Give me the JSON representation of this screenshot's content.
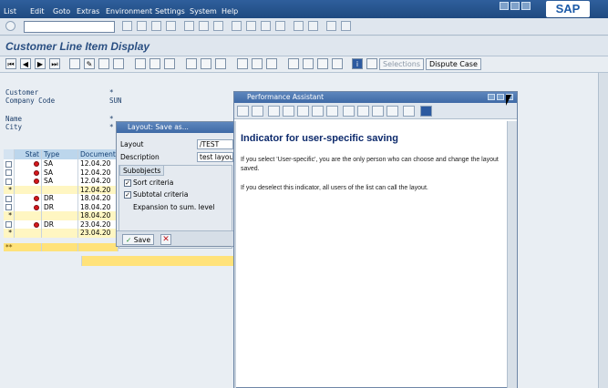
{
  "menu": {
    "items": [
      "List",
      "Edit",
      "Goto",
      "Extras",
      "Environment",
      "Settings",
      "System",
      "Help"
    ],
    "logo": "SAP"
  },
  "screen": {
    "title": "Customer Line Item Display"
  },
  "app_toolbar": {
    "selections_label": "Selections",
    "dispute_label": "Dispute Case"
  },
  "header": {
    "customer_label": "Customer",
    "customer_value": "*",
    "company_label": "Company Code",
    "company_value": "SUN",
    "name_label": "Name",
    "name_value": "*",
    "city_label": "City",
    "city_value": "*"
  },
  "grid": {
    "columns": [
      "Stat",
      "Type",
      "Document"
    ],
    "rows": [
      {
        "kind": "row",
        "type": "SA",
        "date": "12.04.20"
      },
      {
        "kind": "row",
        "type": "SA",
        "date": "12.04.20"
      },
      {
        "kind": "row",
        "type": "SA",
        "date": "12.04.20"
      },
      {
        "kind": "sub",
        "type": "",
        "date": "12.04.20"
      },
      {
        "kind": "row",
        "type": "DR",
        "date": "18.04.20"
      },
      {
        "kind": "row",
        "type": "DR",
        "date": "18.04.20"
      },
      {
        "kind": "sub",
        "type": "",
        "date": "18.04.20"
      },
      {
        "kind": "row",
        "type": "DR",
        "date": "23.04.20"
      },
      {
        "kind": "sub",
        "type": "",
        "date": "23.04.20"
      }
    ],
    "sub_marker": "*",
    "total_marker": "**"
  },
  "layout_dialog": {
    "title": "Layout: Save as...",
    "layout_label": "Layout",
    "layout_value": "/TEST",
    "description_label": "Description",
    "description_value": "test layout",
    "subobjects_label": "Subobjects",
    "sort_criteria": "Sort criteria",
    "subtotal_criteria": "Subtotal criteria",
    "expansion": "Expansion to sum. level",
    "save_label": "Save"
  },
  "assistant": {
    "title": "Performance Assistant",
    "heading": "Indicator for user-specific saving",
    "para1": "If you select 'User-specific', you are the only person who can choose and change the layout saved.",
    "para2": "If you deselect this indicator, all users of the list can call the layout."
  },
  "colors": {
    "menubar": "#1f4a80",
    "title": "#2a4f82",
    "heading": "#0d2a6c",
    "status_red": "#d6171d",
    "subtotal": "#fff6c2",
    "total": "#ffe27a"
  }
}
